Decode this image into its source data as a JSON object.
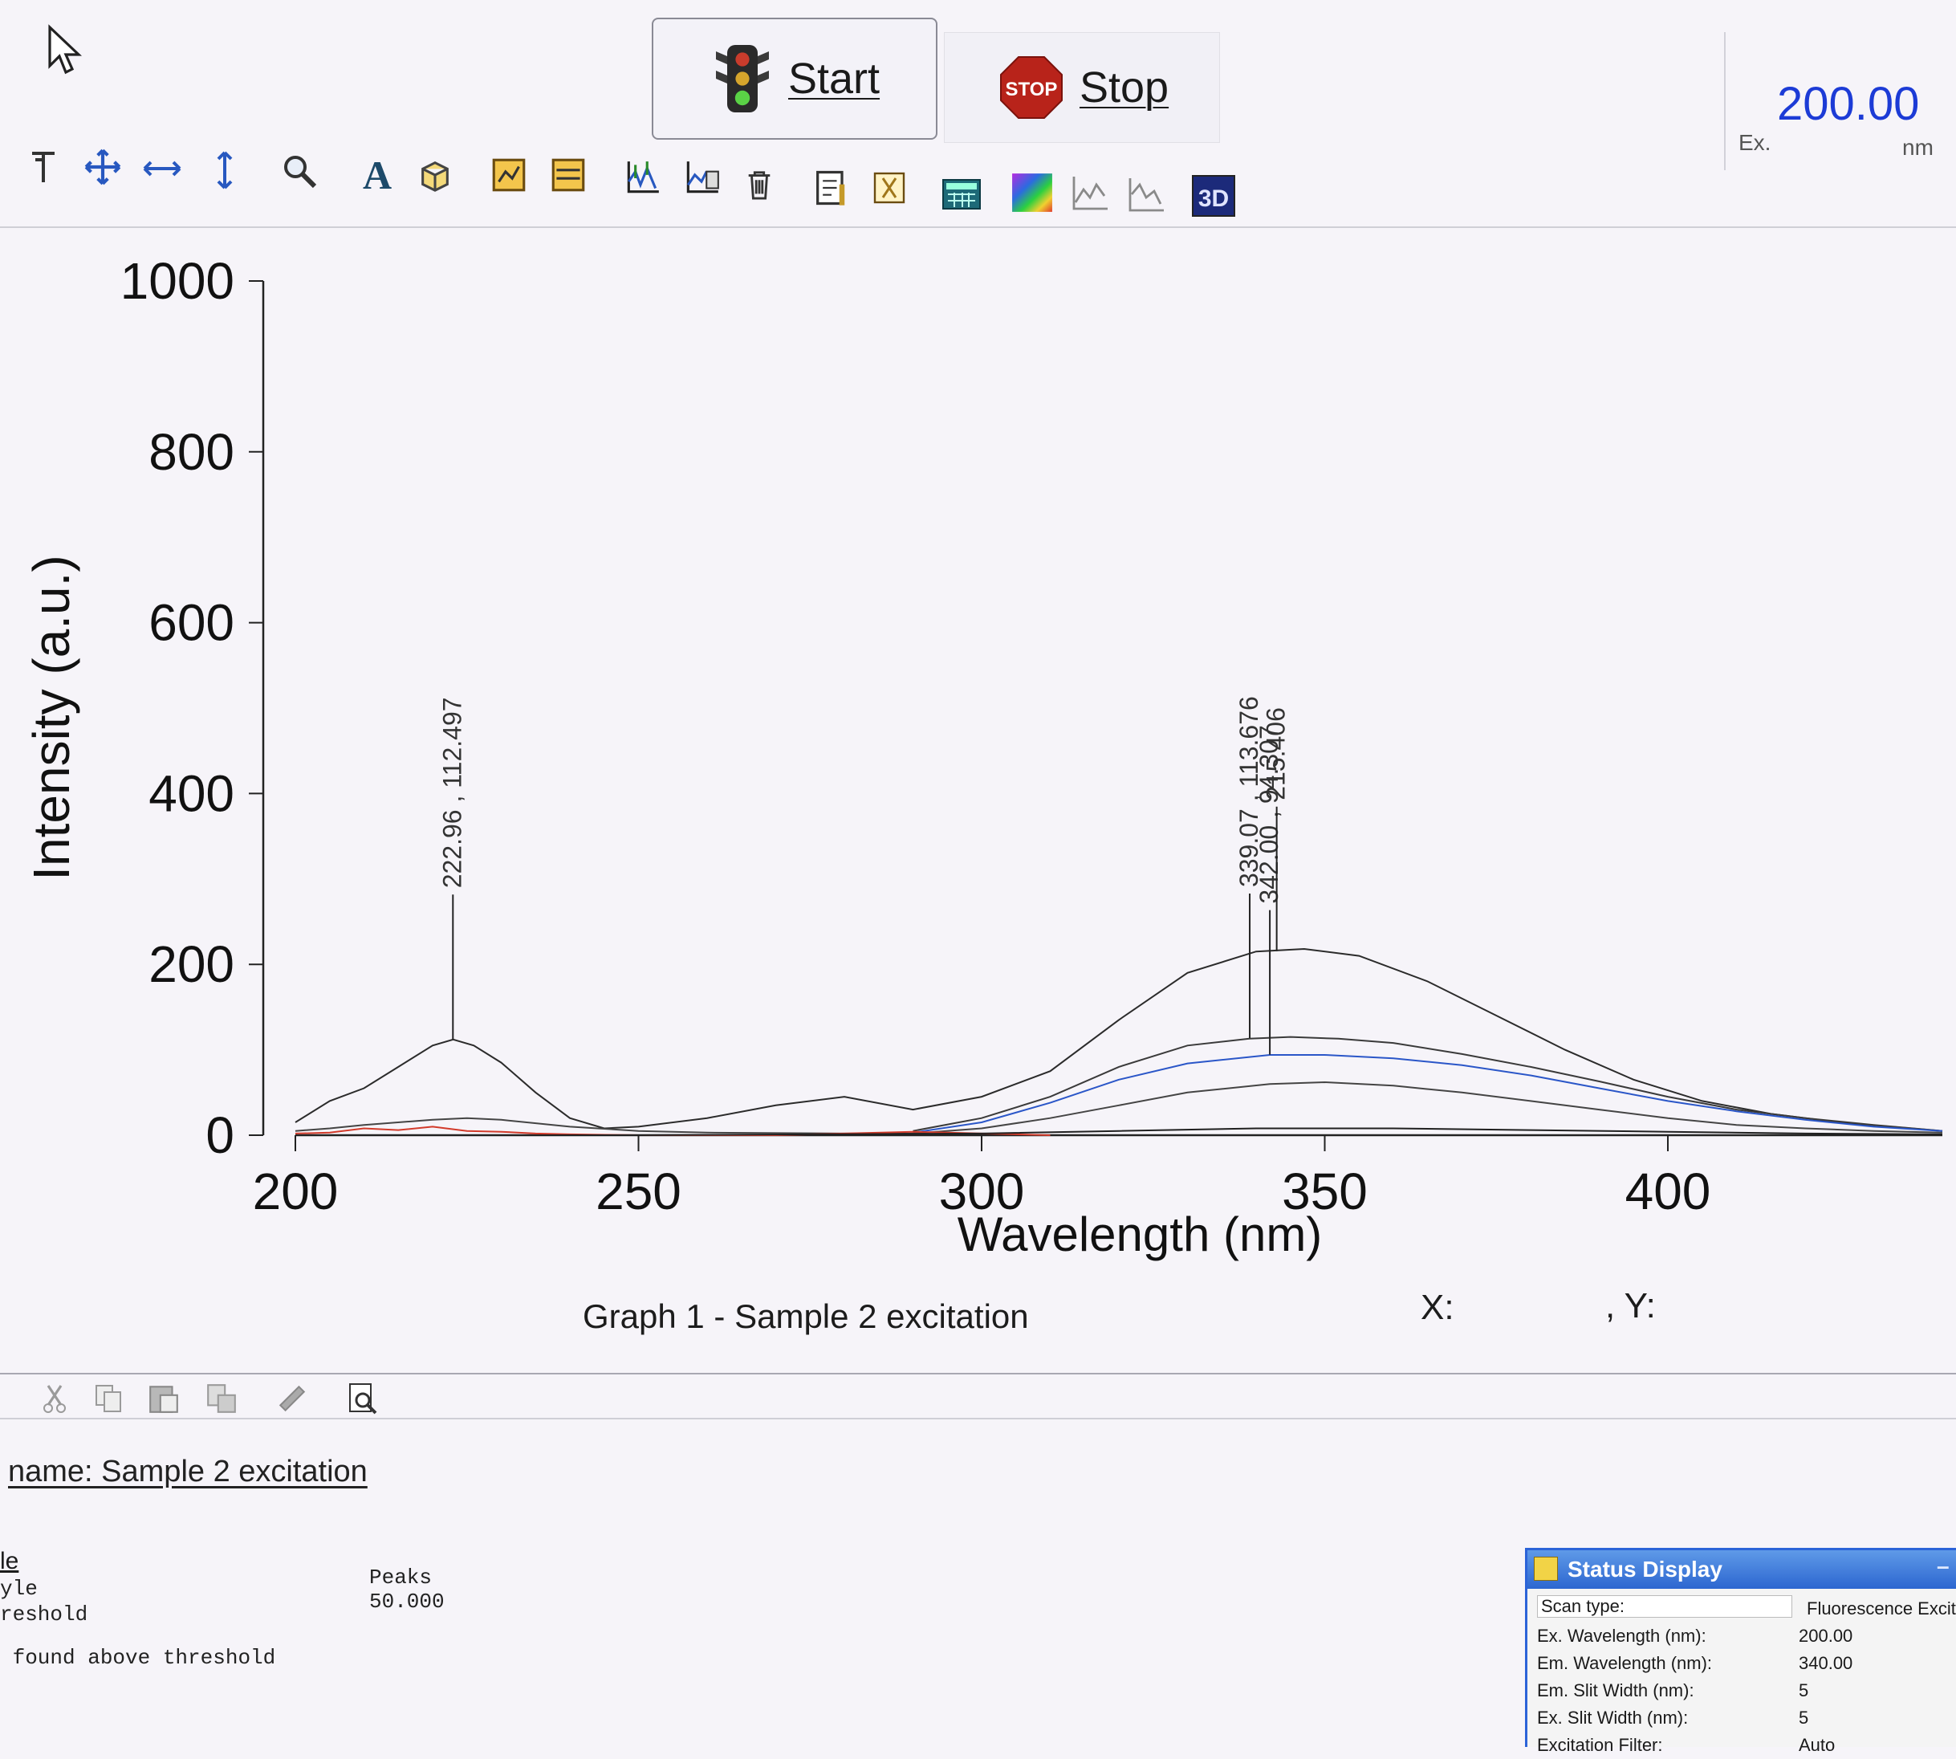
{
  "controls": {
    "start_label": "Start",
    "stop_label": "Stop",
    "ex_wavelength": "200.00",
    "ex_label": "Ex.",
    "ex_unit": "nm"
  },
  "toolbar": {
    "icons": [
      "cursor-select-icon",
      "pan-icon",
      "scale-x-icon",
      "scale-y-icon",
      "zoom-icon",
      "text-annotation-icon",
      "3d-box-icon",
      "graph-format-icon",
      "graph-layout-icon",
      "peak-pick-icon",
      "delete-peaks-icon",
      "trash-icon",
      "report-icon",
      "autoscale-icon",
      "calculator-icon",
      "color-map-icon",
      "overlay-x-icon",
      "overlay-z-icon",
      "3d-view-icon"
    ],
    "icon_3d_text": "3D",
    "icon_text_glyph": "A"
  },
  "graph": {
    "caption": "Graph 1 - Sample 2 excitation",
    "cursor_x_label": "X:",
    "cursor_y_label": ", Y:"
  },
  "chart_data": {
    "type": "line",
    "title": "",
    "xlabel": "Wavelength (nm)",
    "ylabel": "Intensity (a.u.)",
    "xlim": [
      200,
      440
    ],
    "ylim": [
      0,
      1000
    ],
    "xticks": [
      200,
      250,
      300,
      350,
      400
    ],
    "yticks": [
      0,
      200,
      400,
      600,
      800,
      1000
    ],
    "grid": false,
    "series": [
      {
        "color": "#2b2b2b",
        "x": [
          200,
          205,
          210,
          215,
          220,
          223,
          226,
          230,
          235,
          240,
          245,
          250,
          260,
          270,
          280,
          290,
          300,
          310,
          320,
          330,
          340,
          347,
          355,
          365,
          375,
          385,
          395,
          405,
          415,
          425,
          440
        ],
        "y": [
          15,
          40,
          55,
          80,
          105,
          112,
          105,
          85,
          50,
          20,
          8,
          10,
          20,
          35,
          45,
          30,
          45,
          75,
          135,
          190,
          215,
          218,
          210,
          180,
          140,
          100,
          65,
          40,
          25,
          15,
          5
        ]
      },
      {
        "color": "#3a3a3a",
        "x": [
          290,
          300,
          310,
          320,
          330,
          339,
          345,
          352,
          360,
          370,
          380,
          390,
          400,
          410,
          420,
          430,
          440
        ],
        "y": [
          5,
          20,
          45,
          80,
          105,
          113,
          115,
          113,
          108,
          95,
          80,
          63,
          45,
          30,
          20,
          12,
          5
        ]
      },
      {
        "color": "#2a56c8",
        "x": [
          290,
          300,
          310,
          320,
          330,
          342,
          350,
          360,
          370,
          380,
          390,
          400,
          410,
          420,
          430,
          440
        ],
        "y": [
          3,
          15,
          38,
          65,
          84,
          94,
          94,
          90,
          82,
          70,
          55,
          40,
          28,
          18,
          10,
          5
        ]
      },
      {
        "color": "#444444",
        "x": [
          200,
          205,
          210,
          220,
          225,
          230,
          240,
          250,
          260,
          280,
          290,
          300,
          310,
          320,
          330,
          342,
          350,
          360,
          370,
          380,
          390,
          400,
          410,
          420,
          430,
          440
        ],
        "y": [
          5,
          8,
          12,
          18,
          20,
          18,
          10,
          5,
          3,
          2,
          2,
          8,
          20,
          35,
          50,
          60,
          62,
          58,
          50,
          40,
          30,
          20,
          12,
          8,
          5,
          3
        ]
      },
      {
        "color": "#d23a2a",
        "x": [
          200,
          205,
          210,
          215,
          220,
          225,
          230,
          235,
          240,
          250,
          270,
          280,
          290,
          295,
          300,
          305,
          310
        ],
        "y": [
          2,
          3,
          8,
          6,
          10,
          5,
          4,
          2,
          1,
          0,
          0,
          2,
          4,
          3,
          2,
          1,
          0
        ]
      },
      {
        "color": "#202020",
        "x": [
          200,
          250,
          300,
          320,
          340,
          360,
          380,
          400,
          420,
          440
        ],
        "y": [
          0,
          0,
          2,
          5,
          8,
          8,
          6,
          4,
          2,
          1
        ]
      }
    ],
    "annotations": [
      {
        "x": 222.96,
        "y": 112.497,
        "text": "222.96 , 112.497"
      },
      {
        "x": 339.07,
        "y": 113.676,
        "text": "339.07 , 113.676"
      },
      {
        "x": 342.0,
        "y": 94.307,
        "text": "342.00 , 94.307"
      },
      {
        "x": 343.0,
        "y": 215.406,
        "text": "215.406"
      }
    ]
  },
  "edit_toolbar": {
    "icons": [
      "cut-icon",
      "copy-icon",
      "paste-icon",
      "paste-special-icon",
      "print-icon",
      "print-preview-icon"
    ]
  },
  "report": {
    "name": "name: Sample 2 excitation",
    "lines": [
      {
        "left": "le",
        "right": ""
      },
      {
        "left": "yle",
        "right": "Peaks"
      },
      {
        "left": "reshold",
        "right": "50.000"
      },
      {
        "left": " found above threshold",
        "right": ""
      }
    ]
  },
  "status_display": {
    "title": "Status Display",
    "rows": [
      {
        "label": "Scan type:",
        "value": "Fluorescence Excit"
      },
      {
        "label": "Ex. Wavelength (nm):",
        "value": "200.00"
      },
      {
        "label": "Em. Wavelength (nm):",
        "value": "340.00"
      },
      {
        "label": "Em. Slit Width (nm):",
        "value": "5"
      },
      {
        "label": "Ex. Slit Width (nm):",
        "value": "5"
      },
      {
        "label": "Excitation Filter:",
        "value": "Auto"
      }
    ]
  }
}
